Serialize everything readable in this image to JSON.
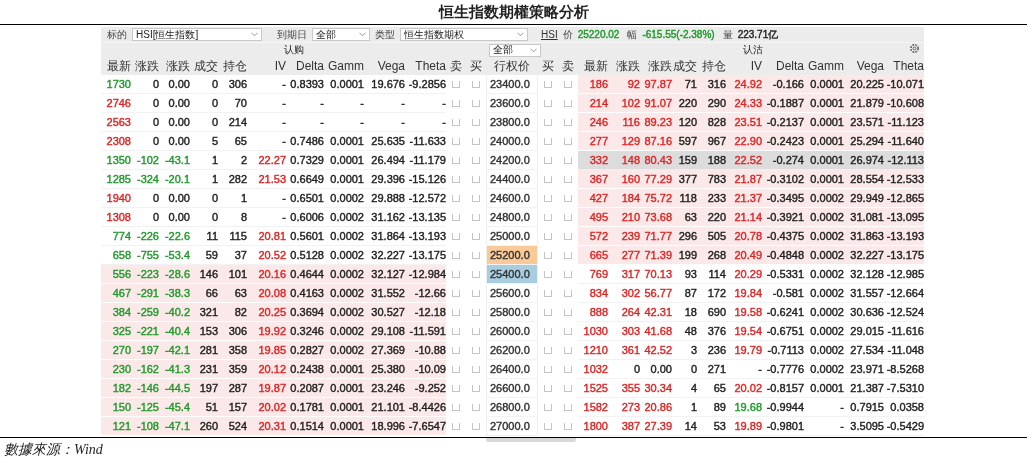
{
  "title": "恒生指数期權策略分析",
  "toolbar": {
    "underlying_label": "标的",
    "underlying": "HSI[恒生指数]",
    "expiry_label": "到期日",
    "expiry": "全部",
    "type_label": "类型",
    "type": "恒生指数期权",
    "symbol": "HSI",
    "price_label": "价",
    "price": {
      "text": "25220.02",
      "color": "#1e9a2a"
    },
    "change_label": "幅",
    "change": {
      "text": "-615.55(-2.38%)",
      "color": "#1e9a2a"
    },
    "volume_label": "量",
    "volume": "223.71亿"
  },
  "sections": {
    "calls": "认购",
    "filter": "全部",
    "puts": "认沽"
  },
  "columns": {
    "call": [
      "最新",
      "涨跌",
      "涨跌",
      "成交",
      "持仓",
      "IV",
      "Delta",
      "Gamm",
      "Vega",
      "Theta"
    ],
    "call_actions": [
      "卖",
      "买"
    ],
    "strike": "行权价",
    "put_actions": [
      "买",
      "卖"
    ],
    "put": [
      "最新",
      "涨跌",
      "涨跌",
      "成交",
      "持仓",
      "IV",
      "Delta",
      "Gamm",
      "Vega",
      "Theta"
    ]
  },
  "rows": [
    {
      "strike": {
        "text": "23400.0"
      },
      "call": {
        "cells": [
          {
            "text": "1730",
            "color": "#1e9a2a"
          },
          {
            "text": "0"
          },
          {
            "text": "0.00"
          },
          {
            "text": "0"
          },
          {
            "text": "306"
          },
          {
            "text": "-"
          },
          {
            "text": "0.8393"
          },
          {
            "text": "0.0001"
          },
          {
            "text": "19.676"
          },
          {
            "text": "-9.2856"
          }
        ],
        "in_the_money": false,
        "sell_checked": false,
        "buy_checked": false
      },
      "put": {
        "cells": [
          {
            "text": "186",
            "color": "#e02424"
          },
          {
            "text": "92",
            "color": "#e02424"
          },
          {
            "text": "97.87",
            "color": "#e02424"
          },
          {
            "text": "71"
          },
          {
            "text": "316"
          },
          {
            "text": "24.92",
            "color": "#e02424"
          },
          {
            "text": "-0.166"
          },
          {
            "text": "0.0001"
          },
          {
            "text": "20.225"
          },
          {
            "text": "-10.071"
          }
        ],
        "in_the_money": true,
        "selected": false,
        "buy_checked": false,
        "sell_checked": false
      }
    },
    {
      "strike": {
        "text": "23600.0"
      },
      "call": {
        "cells": [
          {
            "text": "2746",
            "color": "#e02424"
          },
          {
            "text": "0"
          },
          {
            "text": "0.00"
          },
          {
            "text": "0"
          },
          {
            "text": "70"
          },
          {
            "text": "-"
          },
          {
            "text": "-"
          },
          {
            "text": "-"
          },
          {
            "text": "-"
          },
          {
            "text": "-"
          }
        ],
        "in_the_money": false,
        "sell_checked": false,
        "buy_checked": false
      },
      "put": {
        "cells": [
          {
            "text": "214",
            "color": "#e02424"
          },
          {
            "text": "102",
            "color": "#e02424"
          },
          {
            "text": "91.07",
            "color": "#e02424"
          },
          {
            "text": "220"
          },
          {
            "text": "290"
          },
          {
            "text": "24.33",
            "color": "#e02424"
          },
          {
            "text": "-0.1887"
          },
          {
            "text": "0.0001"
          },
          {
            "text": "21.879"
          },
          {
            "text": "-10.608"
          }
        ],
        "in_the_money": true,
        "selected": false,
        "buy_checked": false,
        "sell_checked": false
      }
    },
    {
      "strike": {
        "text": "23800.0"
      },
      "call": {
        "cells": [
          {
            "text": "2563",
            "color": "#e02424"
          },
          {
            "text": "0"
          },
          {
            "text": "0.00"
          },
          {
            "text": "0"
          },
          {
            "text": "214"
          },
          {
            "text": "-"
          },
          {
            "text": "-"
          },
          {
            "text": "-"
          },
          {
            "text": "-"
          },
          {
            "text": "-"
          }
        ],
        "in_the_money": false,
        "sell_checked": false,
        "buy_checked": false
      },
      "put": {
        "cells": [
          {
            "text": "246",
            "color": "#e02424"
          },
          {
            "text": "116",
            "color": "#e02424"
          },
          {
            "text": "89.23",
            "color": "#e02424"
          },
          {
            "text": "120"
          },
          {
            "text": "828"
          },
          {
            "text": "23.51",
            "color": "#e02424"
          },
          {
            "text": "-0.2137"
          },
          {
            "text": "0.0001"
          },
          {
            "text": "23.571"
          },
          {
            "text": "-11.123"
          }
        ],
        "in_the_money": true,
        "selected": false,
        "buy_checked": false,
        "sell_checked": false
      }
    },
    {
      "strike": {
        "text": "24000.0"
      },
      "call": {
        "cells": [
          {
            "text": "2308",
            "color": "#e02424"
          },
          {
            "text": "0"
          },
          {
            "text": "0.00"
          },
          {
            "text": "5"
          },
          {
            "text": "65"
          },
          {
            "text": "-"
          },
          {
            "text": "0.7486"
          },
          {
            "text": "0.0001"
          },
          {
            "text": "25.635"
          },
          {
            "text": "-11.633"
          }
        ],
        "in_the_money": false,
        "sell_checked": false,
        "buy_checked": false
      },
      "put": {
        "cells": [
          {
            "text": "277",
            "color": "#e02424"
          },
          {
            "text": "129",
            "color": "#e02424"
          },
          {
            "text": "87.16",
            "color": "#e02424"
          },
          {
            "text": "597"
          },
          {
            "text": "967"
          },
          {
            "text": "22.90",
            "color": "#e02424"
          },
          {
            "text": "-0.2423"
          },
          {
            "text": "0.0001"
          },
          {
            "text": "25.294"
          },
          {
            "text": "-11.640"
          }
        ],
        "in_the_money": true,
        "selected": false,
        "buy_checked": false,
        "sell_checked": false
      }
    },
    {
      "strike": {
        "text": "24200.0"
      },
      "call": {
        "cells": [
          {
            "text": "1350",
            "color": "#1e9a2a"
          },
          {
            "text": "-102",
            "color": "#1e9a2a"
          },
          {
            "text": "-43.1",
            "color": "#1e9a2a"
          },
          {
            "text": "1"
          },
          {
            "text": "2"
          },
          {
            "text": "22.27",
            "color": "#e02424"
          },
          {
            "text": "0.7329"
          },
          {
            "text": "0.0001"
          },
          {
            "text": "26.494"
          },
          {
            "text": "-11.179"
          }
        ],
        "in_the_money": false,
        "sell_checked": false,
        "buy_checked": false
      },
      "put": {
        "cells": [
          {
            "text": "332",
            "color": "#e02424"
          },
          {
            "text": "148",
            "color": "#e02424"
          },
          {
            "text": "80.43",
            "color": "#e02424"
          },
          {
            "text": "159"
          },
          {
            "text": "188"
          },
          {
            "text": "22.52",
            "color": "#e02424"
          },
          {
            "text": "-0.274"
          },
          {
            "text": "0.0001"
          },
          {
            "text": "26.974"
          },
          {
            "text": "-12.113"
          }
        ],
        "selected": true,
        "buy_checked": false,
        "sell_checked": false
      }
    },
    {
      "strike": {
        "text": "24400.0"
      },
      "call": {
        "cells": [
          {
            "text": "1285",
            "color": "#1e9a2a"
          },
          {
            "text": "-324",
            "color": "#1e9a2a"
          },
          {
            "text": "-20.1",
            "color": "#1e9a2a"
          },
          {
            "text": "1"
          },
          {
            "text": "282"
          },
          {
            "text": "21.53",
            "color": "#e02424"
          },
          {
            "text": "0.6649"
          },
          {
            "text": "0.0001"
          },
          {
            "text": "29.396"
          },
          {
            "text": "-15.126"
          }
        ],
        "in_the_money": false,
        "sell_checked": false,
        "buy_checked": false
      },
      "put": {
        "cells": [
          {
            "text": "367",
            "color": "#e02424"
          },
          {
            "text": "160",
            "color": "#e02424"
          },
          {
            "text": "77.29",
            "color": "#e02424"
          },
          {
            "text": "377"
          },
          {
            "text": "783"
          },
          {
            "text": "21.87",
            "color": "#e02424"
          },
          {
            "text": "-0.3102"
          },
          {
            "text": "0.0001"
          },
          {
            "text": "28.554"
          },
          {
            "text": "-12.533"
          }
        ],
        "in_the_money": true,
        "selected": false,
        "buy_checked": false,
        "sell_checked": false
      }
    },
    {
      "strike": {
        "text": "24600.0"
      },
      "call": {
        "cells": [
          {
            "text": "1940",
            "color": "#e02424"
          },
          {
            "text": "0"
          },
          {
            "text": "0.00"
          },
          {
            "text": "0"
          },
          {
            "text": "1"
          },
          {
            "text": "-"
          },
          {
            "text": "0.6501"
          },
          {
            "text": "0.0002"
          },
          {
            "text": "29.888"
          },
          {
            "text": "-12.572"
          }
        ],
        "in_the_money": false,
        "sell_checked": false,
        "buy_checked": false
      },
      "put": {
        "cells": [
          {
            "text": "427",
            "color": "#e02424"
          },
          {
            "text": "184",
            "color": "#e02424"
          },
          {
            "text": "75.72",
            "color": "#e02424"
          },
          {
            "text": "118"
          },
          {
            "text": "233"
          },
          {
            "text": "21.37",
            "color": "#e02424"
          },
          {
            "text": "-0.3495"
          },
          {
            "text": "0.0002"
          },
          {
            "text": "29.949"
          },
          {
            "text": "-12.865"
          }
        ],
        "in_the_money": true,
        "selected": false,
        "buy_checked": false,
        "sell_checked": false
      }
    },
    {
      "strike": {
        "text": "24800.0"
      },
      "call": {
        "cells": [
          {
            "text": "1308",
            "color": "#e02424"
          },
          {
            "text": "0"
          },
          {
            "text": "0.00"
          },
          {
            "text": "0"
          },
          {
            "text": "8"
          },
          {
            "text": "-"
          },
          {
            "text": "0.6006"
          },
          {
            "text": "0.0002"
          },
          {
            "text": "31.162"
          },
          {
            "text": "-13.135"
          }
        ],
        "in_the_money": false,
        "sell_checked": false,
        "buy_checked": false
      },
      "put": {
        "cells": [
          {
            "text": "495",
            "color": "#e02424"
          },
          {
            "text": "210",
            "color": "#e02424"
          },
          {
            "text": "73.68",
            "color": "#e02424"
          },
          {
            "text": "63"
          },
          {
            "text": "220"
          },
          {
            "text": "21.14",
            "color": "#e02424"
          },
          {
            "text": "-0.3921"
          },
          {
            "text": "0.0002"
          },
          {
            "text": "31.081"
          },
          {
            "text": "-13.095"
          }
        ],
        "in_the_money": true,
        "selected": false,
        "buy_checked": false,
        "sell_checked": false
      }
    },
    {
      "strike": {
        "text": "25000.0"
      },
      "call": {
        "cells": [
          {
            "text": "774",
            "color": "#1e9a2a"
          },
          {
            "text": "-226",
            "color": "#1e9a2a"
          },
          {
            "text": "-22.6",
            "color": "#1e9a2a"
          },
          {
            "text": "11"
          },
          {
            "text": "115"
          },
          {
            "text": "20.81",
            "color": "#e02424"
          },
          {
            "text": "0.5601"
          },
          {
            "text": "0.0002"
          },
          {
            "text": "31.864"
          },
          {
            "text": "-13.193"
          }
        ],
        "in_the_money": false,
        "sell_checked": false,
        "buy_checked": false
      },
      "put": {
        "cells": [
          {
            "text": "572",
            "color": "#e02424"
          },
          {
            "text": "239",
            "color": "#e02424"
          },
          {
            "text": "71.77",
            "color": "#e02424"
          },
          {
            "text": "296"
          },
          {
            "text": "505"
          },
          {
            "text": "20.78",
            "color": "#e02424"
          },
          {
            "text": "-0.4375"
          },
          {
            "text": "0.0002"
          },
          {
            "text": "31.863"
          },
          {
            "text": "-13.193"
          }
        ],
        "in_the_money": true,
        "selected": false,
        "buy_checked": false,
        "sell_checked": false
      }
    },
    {
      "strike": {
        "text": "25200.0",
        "color": "#f9c998"
      },
      "call": {
        "cells": [
          {
            "text": "658",
            "color": "#1e9a2a"
          },
          {
            "text": "-755",
            "color": "#1e9a2a"
          },
          {
            "text": "-53.4",
            "color": "#1e9a2a"
          },
          {
            "text": "59"
          },
          {
            "text": "37"
          },
          {
            "text": "20.52",
            "color": "#e02424"
          },
          {
            "text": "0.5128"
          },
          {
            "text": "0.0002"
          },
          {
            "text": "32.227"
          },
          {
            "text": "-13.175"
          }
        ],
        "in_the_money": false,
        "sell_checked": false,
        "buy_checked": false
      },
      "put": {
        "cells": [
          {
            "text": "665",
            "color": "#e02424"
          },
          {
            "text": "277",
            "color": "#e02424"
          },
          {
            "text": "71.39",
            "color": "#e02424"
          },
          {
            "text": "199"
          },
          {
            "text": "268"
          },
          {
            "text": "20.49",
            "color": "#e02424"
          },
          {
            "text": "-0.4848"
          },
          {
            "text": "0.0002"
          },
          {
            "text": "32.227"
          },
          {
            "text": "-13.175"
          }
        ],
        "in_the_money": true,
        "selected": false,
        "buy_checked": false,
        "sell_checked": false
      }
    },
    {
      "strike": {
        "text": "25400.0",
        "color": "#a9cde0"
      },
      "call": {
        "cells": [
          {
            "text": "556",
            "color": "#1e9a2a"
          },
          {
            "text": "-223",
            "color": "#1e9a2a"
          },
          {
            "text": "-28.6",
            "color": "#1e9a2a"
          },
          {
            "text": "146"
          },
          {
            "text": "101"
          },
          {
            "text": "20.16",
            "color": "#e02424"
          },
          {
            "text": "0.4644"
          },
          {
            "text": "0.0002"
          },
          {
            "text": "32.127"
          },
          {
            "text": "-12.984"
          }
        ],
        "in_the_money": true,
        "sell_checked": false,
        "buy_checked": false
      },
      "put": {
        "cells": [
          {
            "text": "769",
            "color": "#e02424"
          },
          {
            "text": "317",
            "color": "#e02424"
          },
          {
            "text": "70.13",
            "color": "#e02424"
          },
          {
            "text": "93"
          },
          {
            "text": "114"
          },
          {
            "text": "20.29",
            "color": "#e02424"
          },
          {
            "text": "-0.5331"
          },
          {
            "text": "0.0002"
          },
          {
            "text": "32.128"
          },
          {
            "text": "-12.985"
          }
        ],
        "in_the_money": false,
        "selected": false,
        "buy_checked": false,
        "sell_checked": false
      }
    },
    {
      "strike": {
        "text": "25600.0"
      },
      "call": {
        "cells": [
          {
            "text": "467",
            "color": "#1e9a2a"
          },
          {
            "text": "-291",
            "color": "#1e9a2a"
          },
          {
            "text": "-38.3",
            "color": "#1e9a2a"
          },
          {
            "text": "66"
          },
          {
            "text": "63"
          },
          {
            "text": "20.08",
            "color": "#e02424"
          },
          {
            "text": "0.4163"
          },
          {
            "text": "0.0002"
          },
          {
            "text": "31.552"
          },
          {
            "text": "-12.66"
          }
        ],
        "in_the_money": true,
        "sell_checked": false,
        "buy_checked": false
      },
      "put": {
        "cells": [
          {
            "text": "834",
            "color": "#e02424"
          },
          {
            "text": "302",
            "color": "#e02424"
          },
          {
            "text": "56.77",
            "color": "#e02424"
          },
          {
            "text": "87"
          },
          {
            "text": "172"
          },
          {
            "text": "19.84",
            "color": "#e02424"
          },
          {
            "text": "-0.581"
          },
          {
            "text": "0.0002"
          },
          {
            "text": "31.557"
          },
          {
            "text": "-12.664"
          }
        ],
        "in_the_money": false,
        "selected": false,
        "buy_checked": false,
        "sell_checked": false
      }
    },
    {
      "strike": {
        "text": "25800.0"
      },
      "call": {
        "cells": [
          {
            "text": "384",
            "color": "#1e9a2a"
          },
          {
            "text": "-259",
            "color": "#1e9a2a"
          },
          {
            "text": "-40.2",
            "color": "#1e9a2a"
          },
          {
            "text": "321"
          },
          {
            "text": "82"
          },
          {
            "text": "20.25",
            "color": "#e02424"
          },
          {
            "text": "0.3694"
          },
          {
            "text": "0.0002"
          },
          {
            "text": "30.527"
          },
          {
            "text": "-12.18"
          }
        ],
        "in_the_money": true,
        "sell_checked": false,
        "buy_checked": false
      },
      "put": {
        "cells": [
          {
            "text": "888",
            "color": "#e02424"
          },
          {
            "text": "264",
            "color": "#e02424"
          },
          {
            "text": "42.31",
            "color": "#e02424"
          },
          {
            "text": "18"
          },
          {
            "text": "690"
          },
          {
            "text": "19.58",
            "color": "#e02424"
          },
          {
            "text": "-0.6241"
          },
          {
            "text": "0.0002"
          },
          {
            "text": "30.636"
          },
          {
            "text": "-12.524"
          }
        ],
        "in_the_money": false,
        "selected": false,
        "buy_checked": false,
        "sell_checked": false
      }
    },
    {
      "strike": {
        "text": "26000.0"
      },
      "call": {
        "cells": [
          {
            "text": "325",
            "color": "#1e9a2a"
          },
          {
            "text": "-221",
            "color": "#1e9a2a"
          },
          {
            "text": "-40.4",
            "color": "#1e9a2a"
          },
          {
            "text": "153"
          },
          {
            "text": "306"
          },
          {
            "text": "19.92",
            "color": "#e02424"
          },
          {
            "text": "0.3246"
          },
          {
            "text": "0.0002"
          },
          {
            "text": "29.108"
          },
          {
            "text": "-11.591"
          }
        ],
        "in_the_money": true,
        "sell_checked": false,
        "buy_checked": false
      },
      "put": {
        "cells": [
          {
            "text": "1030",
            "color": "#e02424"
          },
          {
            "text": "303",
            "color": "#e02424"
          },
          {
            "text": "41.68",
            "color": "#e02424"
          },
          {
            "text": "48"
          },
          {
            "text": "376"
          },
          {
            "text": "19.54",
            "color": "#e02424"
          },
          {
            "text": "-0.6751"
          },
          {
            "text": "0.0002"
          },
          {
            "text": "29.015"
          },
          {
            "text": "-11.616"
          }
        ],
        "in_the_money": false,
        "selected": false,
        "buy_checked": false,
        "sell_checked": false
      }
    },
    {
      "strike": {
        "text": "26200.0"
      },
      "call": {
        "cells": [
          {
            "text": "270",
            "color": "#1e9a2a"
          },
          {
            "text": "-197",
            "color": "#1e9a2a"
          },
          {
            "text": "-42.1",
            "color": "#1e9a2a"
          },
          {
            "text": "281"
          },
          {
            "text": "358"
          },
          {
            "text": "19.85",
            "color": "#e02424"
          },
          {
            "text": "0.2827"
          },
          {
            "text": "0.0002"
          },
          {
            "text": "27.369"
          },
          {
            "text": "-10.88"
          }
        ],
        "in_the_money": true,
        "sell_checked": false,
        "buy_checked": false
      },
      "put": {
        "cells": [
          {
            "text": "1210",
            "color": "#e02424"
          },
          {
            "text": "361",
            "color": "#e02424"
          },
          {
            "text": "42.52",
            "color": "#e02424"
          },
          {
            "text": "3"
          },
          {
            "text": "236"
          },
          {
            "text": "19.79",
            "color": "#e02424"
          },
          {
            "text": "-0.7113"
          },
          {
            "text": "0.0002"
          },
          {
            "text": "27.534"
          },
          {
            "text": "-11.048"
          }
        ],
        "in_the_money": false,
        "selected": false,
        "buy_checked": false,
        "sell_checked": false
      }
    },
    {
      "strike": {
        "text": "26400.0"
      },
      "call": {
        "cells": [
          {
            "text": "230",
            "color": "#1e9a2a"
          },
          {
            "text": "-162",
            "color": "#1e9a2a"
          },
          {
            "text": "-41.3",
            "color": "#1e9a2a"
          },
          {
            "text": "231"
          },
          {
            "text": "359"
          },
          {
            "text": "20.12",
            "color": "#e02424"
          },
          {
            "text": "0.2438"
          },
          {
            "text": "0.0001"
          },
          {
            "text": "25.380"
          },
          {
            "text": "-10.09"
          }
        ],
        "in_the_money": true,
        "sell_checked": false,
        "buy_checked": false
      },
      "put": {
        "cells": [
          {
            "text": "1032",
            "color": "#e02424"
          },
          {
            "text": "0"
          },
          {
            "text": "0.00"
          },
          {
            "text": "0"
          },
          {
            "text": "271"
          },
          {
            "text": "-"
          },
          {
            "text": "-0.7776"
          },
          {
            "text": "0.0002"
          },
          {
            "text": "23.971"
          },
          {
            "text": "-8.5268"
          }
        ],
        "in_the_money": false,
        "selected": false,
        "buy_checked": false,
        "sell_checked": false
      }
    },
    {
      "strike": {
        "text": "26600.0"
      },
      "call": {
        "cells": [
          {
            "text": "182",
            "color": "#1e9a2a"
          },
          {
            "text": "-146",
            "color": "#1e9a2a"
          },
          {
            "text": "-44.5",
            "color": "#1e9a2a"
          },
          {
            "text": "197"
          },
          {
            "text": "287"
          },
          {
            "text": "19.87",
            "color": "#e02424"
          },
          {
            "text": "0.2087"
          },
          {
            "text": "0.0001"
          },
          {
            "text": "23.246"
          },
          {
            "text": "-9.252"
          }
        ],
        "in_the_money": true,
        "sell_checked": false,
        "buy_checked": false
      },
      "put": {
        "cells": [
          {
            "text": "1525",
            "color": "#e02424"
          },
          {
            "text": "355",
            "color": "#e02424"
          },
          {
            "text": "30.34",
            "color": "#e02424"
          },
          {
            "text": "4"
          },
          {
            "text": "65"
          },
          {
            "text": "20.02",
            "color": "#e02424"
          },
          {
            "text": "-0.8157"
          },
          {
            "text": "0.0001"
          },
          {
            "text": "21.387"
          },
          {
            "text": "-7.5310"
          }
        ],
        "in_the_money": false,
        "selected": false,
        "buy_checked": false,
        "sell_checked": false
      }
    },
    {
      "strike": {
        "text": "26800.0"
      },
      "call": {
        "cells": [
          {
            "text": "150",
            "color": "#1e9a2a"
          },
          {
            "text": "-125",
            "color": "#1e9a2a"
          },
          {
            "text": "-45.4",
            "color": "#1e9a2a"
          },
          {
            "text": "51"
          },
          {
            "text": "157"
          },
          {
            "text": "20.02",
            "color": "#e02424"
          },
          {
            "text": "0.1781"
          },
          {
            "text": "0.0001"
          },
          {
            "text": "21.101"
          },
          {
            "text": "-8.4426"
          }
        ],
        "in_the_money": true,
        "sell_checked": false,
        "buy_checked": false
      },
      "put": {
        "cells": [
          {
            "text": "1582",
            "color": "#e02424"
          },
          {
            "text": "273",
            "color": "#e02424"
          },
          {
            "text": "20.86",
            "color": "#e02424"
          },
          {
            "text": "1"
          },
          {
            "text": "89"
          },
          {
            "text": "19.68",
            "color": "#1e9a2a"
          },
          {
            "text": "-0.9944"
          },
          {
            "text": "-"
          },
          {
            "text": "0.7915"
          },
          {
            "text": "0.0358"
          }
        ],
        "in_the_money": false,
        "selected": false,
        "buy_checked": false,
        "sell_checked": false
      }
    },
    {
      "strike": {
        "text": "27000.0"
      },
      "call": {
        "cells": [
          {
            "text": "121",
            "color": "#1e9a2a"
          },
          {
            "text": "-108",
            "color": "#1e9a2a"
          },
          {
            "text": "-47.1",
            "color": "#1e9a2a"
          },
          {
            "text": "260"
          },
          {
            "text": "524"
          },
          {
            "text": "20.31",
            "color": "#e02424"
          },
          {
            "text": "0.1514"
          },
          {
            "text": "0.0001"
          },
          {
            "text": "18.996"
          },
          {
            "text": "-7.6547"
          }
        ],
        "in_the_money": true,
        "sell_checked": false,
        "buy_checked": false
      },
      "put": {
        "cells": [
          {
            "text": "1800",
            "color": "#e02424"
          },
          {
            "text": "387",
            "color": "#e02424"
          },
          {
            "text": "27.39",
            "color": "#e02424"
          },
          {
            "text": "14"
          },
          {
            "text": "53"
          },
          {
            "text": "19.89",
            "color": "#e02424"
          },
          {
            "text": "-0.9801"
          },
          {
            "text": "-"
          },
          {
            "text": "3.5095"
          },
          {
            "text": "-0.5429"
          }
        ],
        "in_the_money": false,
        "selected": false,
        "buy_checked": false,
        "sell_checked": false
      }
    }
  ],
  "source": "數據來源：Wind"
}
